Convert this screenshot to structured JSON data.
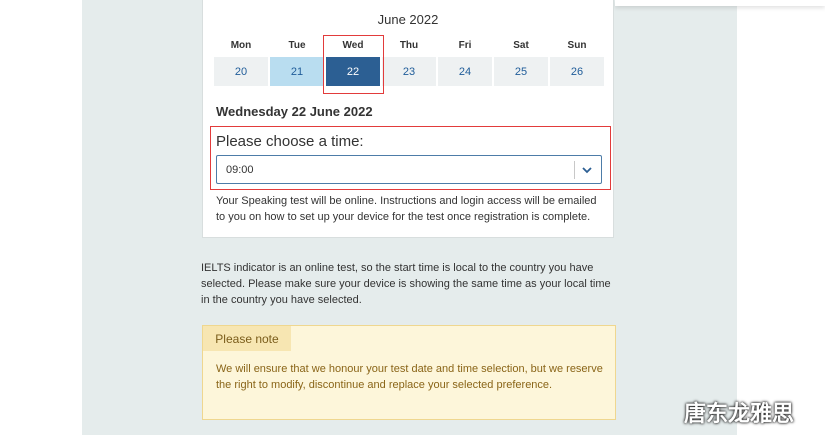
{
  "calendar": {
    "month_title": "June 2022",
    "days": [
      "Mon",
      "Tue",
      "Wed",
      "Thu",
      "Fri",
      "Sat",
      "Sun"
    ],
    "dates": [
      "20",
      "21",
      "22",
      "23",
      "24",
      "25",
      "26"
    ]
  },
  "selected_date_heading": "Wednesday 22 June 2022",
  "time_select": {
    "label": "Please choose a time:",
    "value": "09:00"
  },
  "speaking_info": "Your Speaking test will be online. Instructions and login access will be emailed to you on how to set up your device for the test once registration is complete.",
  "timezone_note": "IELTS indicator is an online test, so the start time is local to the country you have selected. Please make sure your device is showing the same time as your local time in the country you have selected.",
  "notice": {
    "header": "Please note",
    "text": "We will ensure that we honour your test date and time selection, but we reserve the right to modify, discontinue and replace your selected preference."
  },
  "watermark": "唐东龙雅思",
  "colors": {
    "selected_date": "#2c5f93",
    "available_date": "#b9ddf0",
    "highlight_box": "#e23b3b",
    "notice_bg": "#fdf6da"
  }
}
